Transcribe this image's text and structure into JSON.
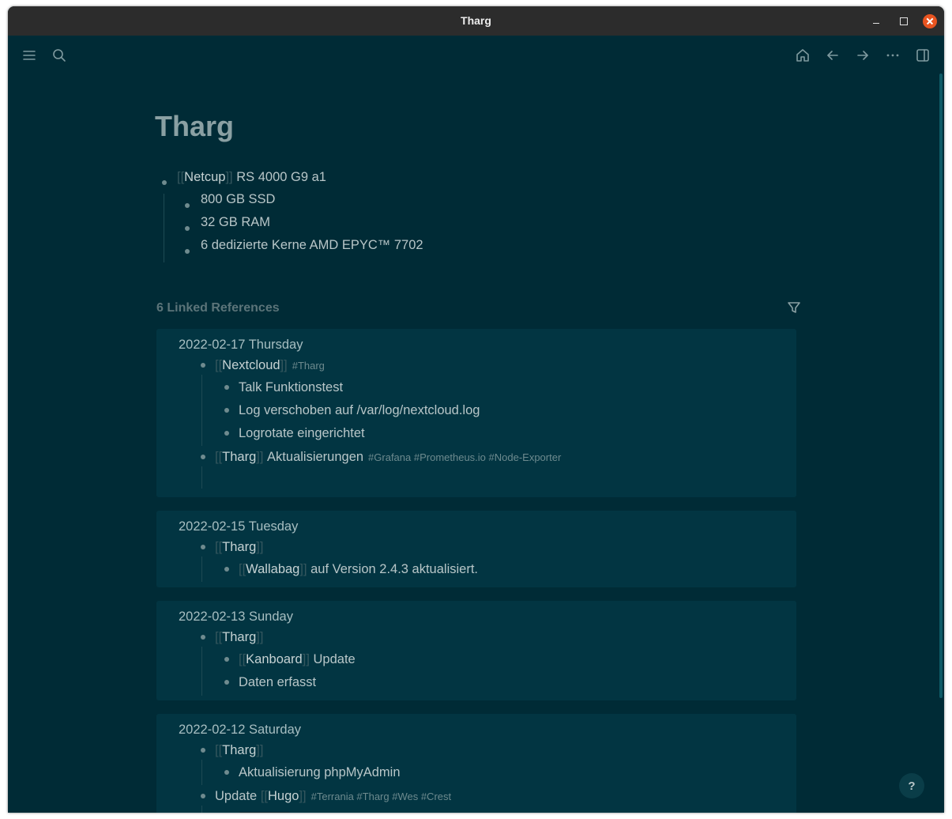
{
  "window": {
    "title": "Tharg"
  },
  "toolbar": {
    "left": [
      "menu-icon",
      "search-icon"
    ],
    "right": [
      "home-icon",
      "arrow-left-icon",
      "arrow-right-icon",
      "more-icon",
      "sidebar-toggle-icon"
    ]
  },
  "page": {
    "title": "Tharg",
    "blocks": {
      "b0": {
        "open": "[[",
        "ref": "Netcup",
        "close": "]]",
        "text": "RS 4000 G9 a1"
      },
      "b1": "800 GB SSD",
      "b2": "32 GB RAM",
      "b3": "6 dedizierte Kerne AMD EPYC™ 7702"
    }
  },
  "references": {
    "header": "6 Linked References",
    "r1": {
      "date": "2022-02-17 Thursday",
      "l1": {
        "open": "[[",
        "ref": "Nextcloud",
        "close": "]]",
        "tag": "#Tharg"
      },
      "l1a": "Talk Funktionstest",
      "l1b": "Log verschoben auf /var/log/nextcloud.log",
      "l1c": "Logrotate eingerichtet",
      "l2": {
        "open": "[[",
        "ref": "Tharg",
        "close": "]]",
        "text": "Aktualisierungen",
        "tags": "#Grafana #Prometheus.io #Node-Exporter"
      }
    },
    "r2": {
      "date": "2022-02-15 Tuesday",
      "l1": {
        "open": "[[",
        "ref": "Tharg",
        "close": "]]"
      },
      "l1a": {
        "open": "[[",
        "ref": "Wallabag",
        "close": "]]",
        "text": "auf Version 2.4.3 aktualisiert."
      }
    },
    "r3": {
      "date": "2022-02-13 Sunday",
      "l1": {
        "open": "[[",
        "ref": "Tharg",
        "close": "]]"
      },
      "l1a": {
        "open": "[[",
        "ref": "Kanboard",
        "close": "]]",
        "text": "Update"
      },
      "l1b": "Daten erfasst"
    },
    "r4": {
      "date": "2022-02-12 Saturday",
      "l1": {
        "open": "[[",
        "ref": "Tharg",
        "close": "]]"
      },
      "l1a": "Aktualisierung phpMyAdmin",
      "l2": {
        "pre": "Update",
        "open": "[[",
        "ref": "Hugo",
        "close": "]]",
        "tags": "#Terrania #Tharg #Wes #Crest"
      }
    }
  },
  "help": {
    "label": "?"
  },
  "colors": {
    "background": "#002b36",
    "card": "#023542",
    "titlebar": "#2c2c2c",
    "close": "#e95420"
  }
}
